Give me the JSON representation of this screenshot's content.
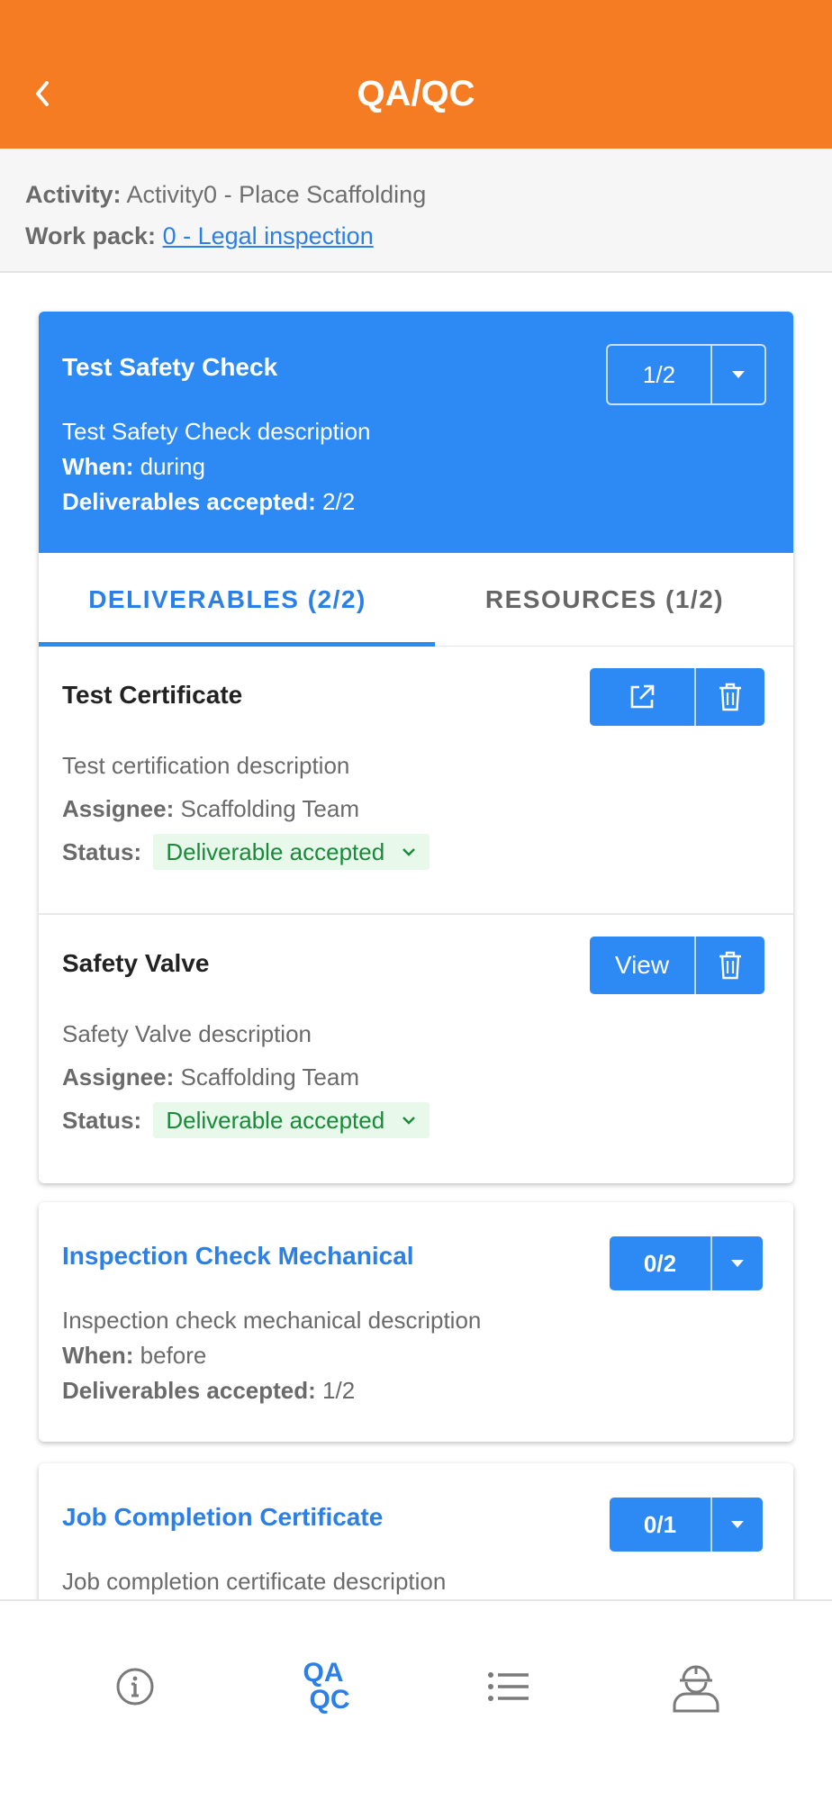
{
  "header": {
    "title": "QA/QC",
    "colors": {
      "header_bg": "#f57c22",
      "accent": "#2d89f3",
      "status_bg": "#e8f8ea",
      "status_text": "#188a3a"
    }
  },
  "context": {
    "activity_label": "Activity:",
    "activity_value": "Activity0 - Place Scaffolding",
    "workpack_label": "Work pack:",
    "workpack_value": "0 - Legal inspection"
  },
  "checks": [
    {
      "title": "Test Safety Check",
      "counter": "1/2",
      "description": "Test Safety Check description",
      "when_label": "When:",
      "when_value": "during",
      "accepted_label": "Deliverables accepted:",
      "accepted_value": "2/2",
      "tabs": [
        "DELIVERABLES (2/2)",
        "RESOURCES (1/2)"
      ],
      "deliverables": [
        {
          "title": "Test Certificate",
          "description": "Test certification description",
          "assignee_label": "Assignee:",
          "assignee_value": "Scaffolding Team",
          "status_label": "Status:",
          "status_value": "Deliverable accepted",
          "primary_action_icon": "external-link-icon"
        },
        {
          "title": "Safety Valve",
          "description": "Safety Valve description",
          "assignee_label": "Assignee:",
          "assignee_value": "Scaffolding Team",
          "status_label": "Status:",
          "status_value": "Deliverable accepted",
          "primary_action_label": "View"
        }
      ]
    },
    {
      "title": "Inspection Check Mechanical",
      "counter": "0/2",
      "description": "Inspection check mechanical description",
      "when_label": "When:",
      "when_value": "before",
      "accepted_label": "Deliverables accepted:",
      "accepted_value": "1/2"
    },
    {
      "title": "Job Completion Certificate",
      "counter": "0/1",
      "description": "Job completion certificate description"
    }
  ],
  "bottom_nav": {
    "items": [
      {
        "icon": "info-icon"
      },
      {
        "label_line1": "QA",
        "label_line2": "QC"
      },
      {
        "icon": "list-icon"
      },
      {
        "icon": "worker-helmet-icon"
      }
    ]
  }
}
